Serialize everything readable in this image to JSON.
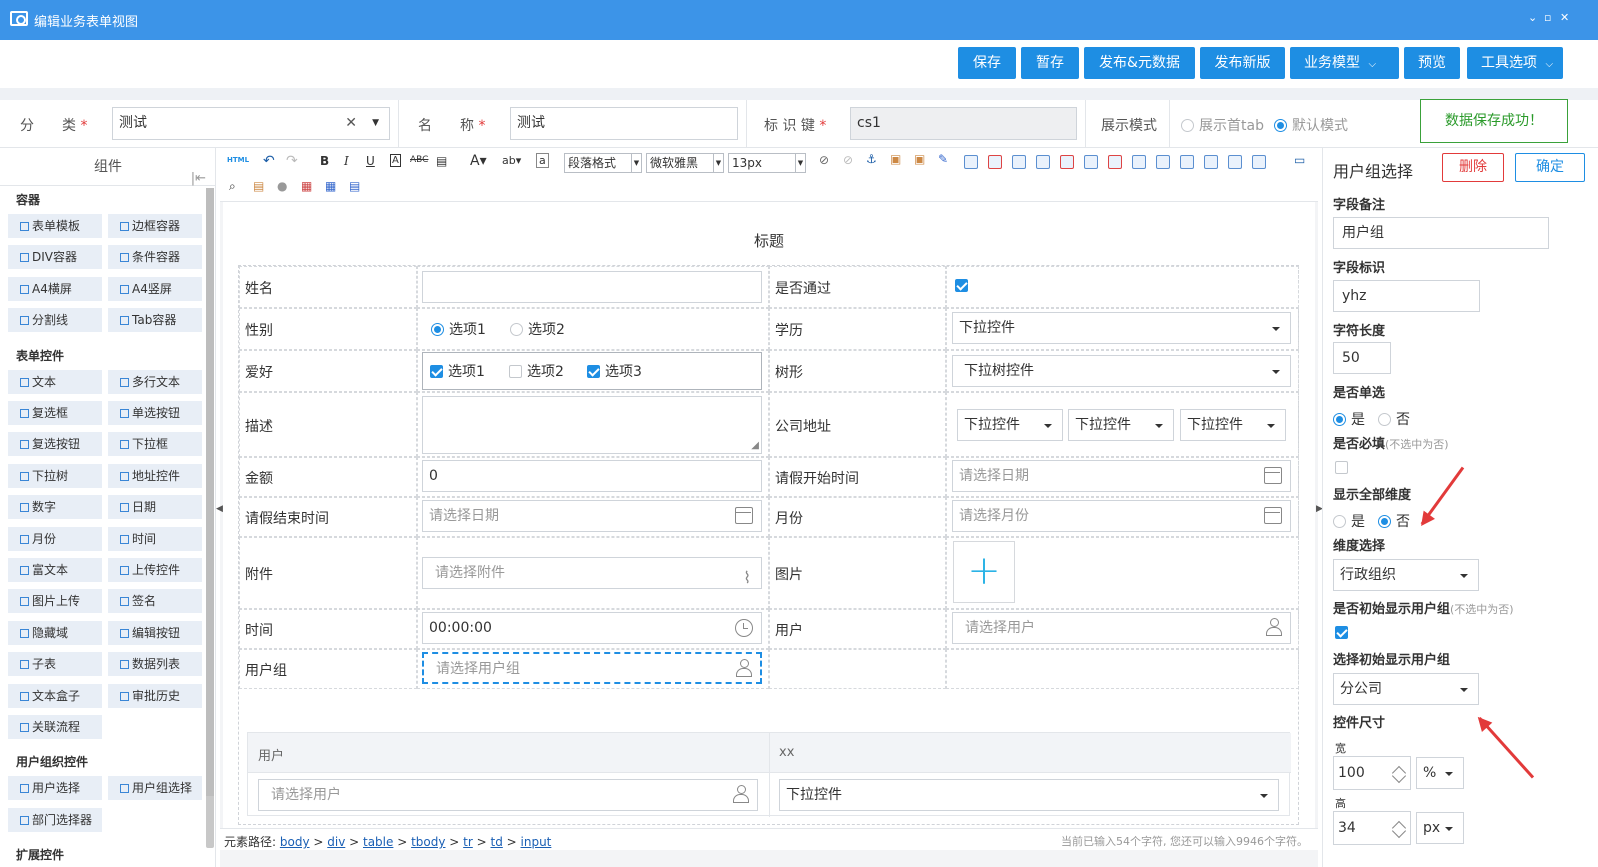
{
  "window": {
    "title": "编辑业务表单视图"
  },
  "actions": {
    "save": "保存",
    "draft": "暂存",
    "publish_meta": "发布&元数据",
    "publish_new": "发布新版",
    "biz_model": "业务模型",
    "preview": "预览",
    "tools": "工具选项"
  },
  "meta": {
    "category_label": "分　　类",
    "category_value": "测试",
    "name_label": "名　　称",
    "name_value": "测试",
    "key_label": "标 识 键",
    "key_value": "cs1",
    "display_label": "展示模式",
    "opt_first_tab": "展示首tab",
    "opt_default": "默认模式"
  },
  "toast": "数据保存成功！",
  "left": {
    "header": "组件",
    "sections": [
      {
        "title": "容器",
        "items": [
          "表单模板",
          "边框容器",
          "DIV容器",
          "条件容器",
          "A4横屏",
          "A4竖屏",
          "分割线",
          "Tab容器"
        ]
      },
      {
        "title": "表单控件",
        "items": [
          "文本",
          "多行文本",
          "复选框",
          "单选按钮",
          "复选按钮",
          "下拉框",
          "下拉树",
          "地址控件",
          "数字",
          "日期",
          "月份",
          "时间",
          "富文本",
          "上传控件",
          "图片上传",
          "签名",
          "隐藏域",
          "编辑按钮",
          "子表",
          "数据列表",
          "文本盒子",
          "审批历史",
          "关联流程"
        ]
      },
      {
        "title": "用户组织控件",
        "items": [
          "用户选择",
          "用户组选择",
          "部门选择器"
        ]
      },
      {
        "title": "扩展控件",
        "items": []
      }
    ]
  },
  "toolbar": {
    "paragraph": "段落格式",
    "font": "微软雅黑",
    "size": "13px"
  },
  "form": {
    "title": "标题",
    "name_label": "姓名",
    "pass_label": "是否通过",
    "gender_label": "性别",
    "opt1": "选项1",
    "opt2": "选项2",
    "opt3": "选项3",
    "edu_label": "学历",
    "dropdown": "下拉控件",
    "hobby_label": "爱好",
    "tree_label": "树形",
    "tree_dropdown": "下拉树控件",
    "desc_label": "描述",
    "addr_label": "公司地址",
    "amount_label": "金额",
    "amount_value": "0",
    "leave_start_label": "请假开始时间",
    "date_ph": "请选择日期",
    "leave_end_label": "请假结束时间",
    "month_label": "月份",
    "month_ph": "请选择月份",
    "attach_label": "附件",
    "attach_ph": "请选择附件",
    "image_label": "图片",
    "time_label": "时间",
    "time_value": "00:00:00",
    "user_label": "用户",
    "user_ph": "请选择用户",
    "group_label": "用户组",
    "group_ph": "请选择用户组",
    "sub_col_user": "用户",
    "sub_col_xx": "xx"
  },
  "pathbar": {
    "prefix": "元素路径:",
    "body": "body",
    "div": "div",
    "table": "table",
    "tbody": "tbody",
    "tr": "tr",
    "td": "td",
    "input": "input",
    "counter": "当前已输入54个字符, 您还可以输入9946个字符。"
  },
  "right": {
    "title": "用户组选择",
    "delete": "删除",
    "confirm": "确定",
    "remark_label": "字段备注",
    "remark_value": "用户组",
    "key_label": "字段标识",
    "key_value": "yhz",
    "len_label": "字符长度",
    "len_value": "50",
    "single_label": "是否单选",
    "yes": "是",
    "no": "否",
    "required_label": "是否必填",
    "required_hint": "(不选中为否)",
    "dims_label": "显示全部维度",
    "dim_select_label": "维度选择",
    "dim_value": "行政组织",
    "init_show_label": "是否初始显示用户组",
    "init_show_hint": "(不选中为否)",
    "init_group_label": "选择初始显示用户组",
    "init_group_value": "分公司",
    "size_label": "控件尺寸",
    "width_label": "宽",
    "width_value": "100",
    "width_unit": "%",
    "height_label": "高",
    "height_value": "34",
    "height_unit": "px"
  },
  "colors": {
    "primary": "#1e8ee3",
    "titlebar": "#3c94e8",
    "success": "#2a9a2a",
    "danger": "#e23a3a"
  }
}
